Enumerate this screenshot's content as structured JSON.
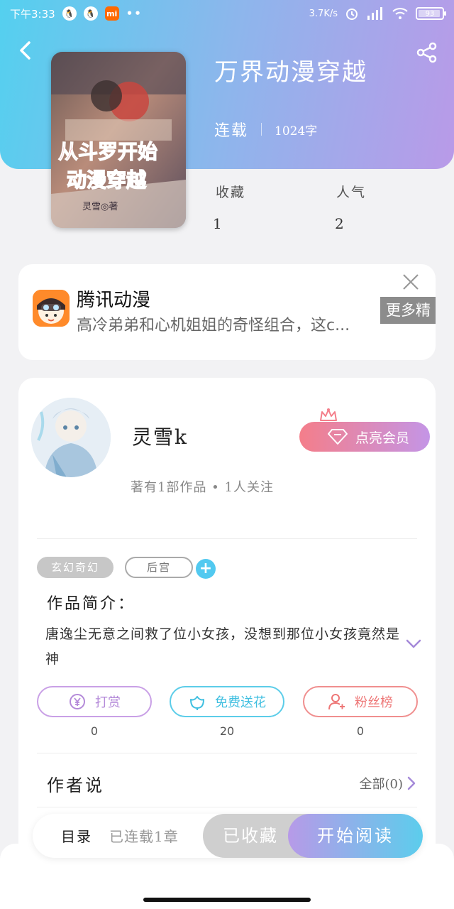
{
  "status_bar": {
    "time": "下午3:33",
    "speed": "3.7K/s",
    "battery": "93",
    "battery_level": 0.93,
    "apps": [
      "qq-icon",
      "qq-icon",
      "mi-icon"
    ]
  },
  "book": {
    "title": "万界动漫穿越",
    "status": "连载",
    "words": "1024字",
    "cover_title_line1": "从斗罗开始",
    "cover_title_line2": "动漫穿越",
    "cover_author": "灵雪◎著"
  },
  "stats": [
    {
      "label": "收藏",
      "value": "1"
    },
    {
      "label": "人气",
      "value": "2"
    }
  ],
  "ad": {
    "title": "腾讯动漫",
    "desc": "高冷弟弟和心机姐姐的奇怪组合，这c...",
    "more": "更多精"
  },
  "author": {
    "name": "灵雪k",
    "works": "著有1部作品 • 1人关注",
    "vip_label": "点亮会员"
  },
  "tags": {
    "genre": "玄幻奇幻",
    "sub": "后宫",
    "add": "+"
  },
  "intro": {
    "label": "作品简介：",
    "text": "唐逸尘无意之间救了位小女孩，没想到那位小女孩竟然是神"
  },
  "actions": {
    "reward": {
      "label": "打赏",
      "count": "0"
    },
    "flower": {
      "label": "免费送花",
      "count": "20"
    },
    "fans": {
      "label": "粉丝榜",
      "count": "0"
    }
  },
  "author_say": {
    "label": "作者说",
    "all": "全部(0)"
  },
  "bottom": {
    "toc": "目录",
    "toc_status": "已连载1章",
    "collected": "已收藏",
    "read": "开始阅读"
  },
  "colors": {
    "header_start": "#54d0ef",
    "header_end": "#b99ae8",
    "vip_start": "#f47e8a",
    "vip_end": "#c495e6",
    "accent_blue": "#52c9f0"
  }
}
